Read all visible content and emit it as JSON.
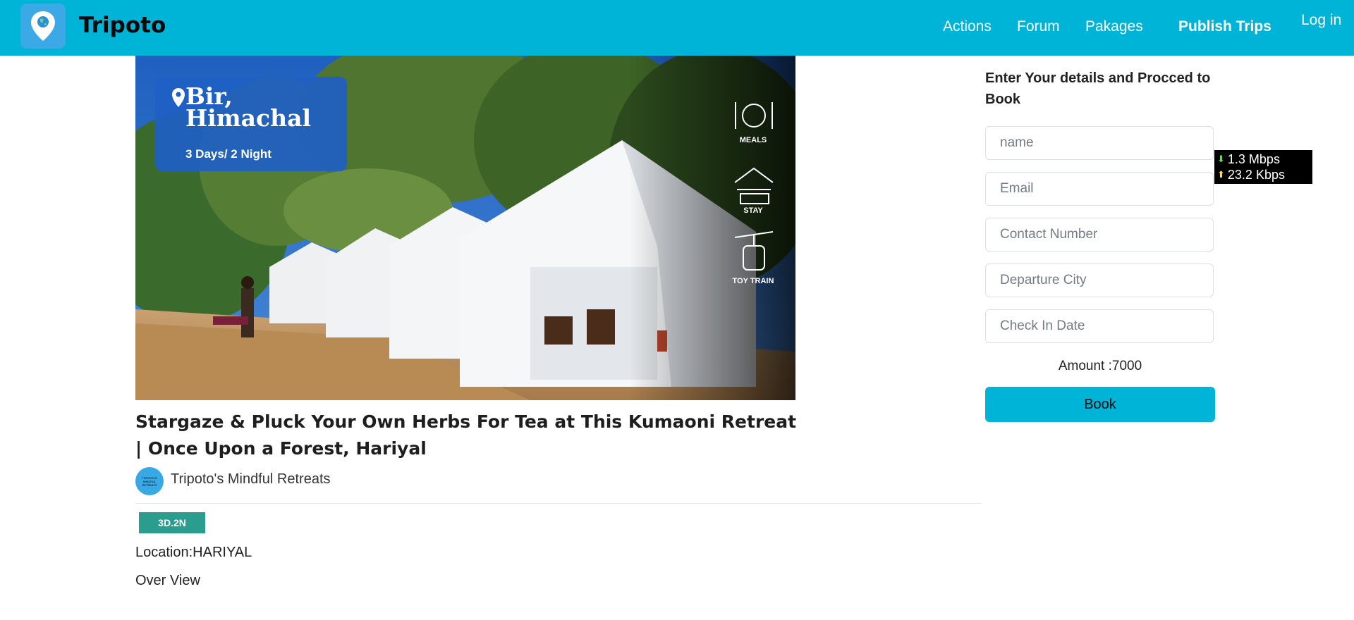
{
  "header": {
    "brand": "Tripoto",
    "nav": [
      {
        "label": "Actions"
      },
      {
        "label": "Forum"
      },
      {
        "label": "Pakages"
      },
      {
        "label": "Publish Trips"
      },
      {
        "label": "Log in"
      }
    ],
    "brand_color": "#00b4d8"
  },
  "hero": {
    "location_line1": "Bir,",
    "location_line2": "Himachal",
    "duration": "3 Days/ 2 Night",
    "amenities": [
      {
        "label": "MEALS",
        "icon": "plate-cutlery-icon"
      },
      {
        "label": "STAY",
        "icon": "bed-icon"
      },
      {
        "label": "TOY TRAIN",
        "icon": "cable-car-icon"
      }
    ]
  },
  "post": {
    "title": "Stargaze & Pluck Your Own Herbs For Tea at This Kumaoni Retreat | Once Upon a Forest, Hariyal",
    "author": "Tripoto's Mindful Retreats",
    "avatar_text": "TRIPOTO'S MINDFUL RETREATS",
    "badge": "3D.2N",
    "location": "Location:HARIYAL",
    "overview": "Over View"
  },
  "booking": {
    "title": "Enter Your details and Procced to Book",
    "fields": [
      {
        "placeholder": "name"
      },
      {
        "placeholder": "Email"
      },
      {
        "placeholder": "Contact Number"
      },
      {
        "placeholder": "Departure City"
      },
      {
        "placeholder": "Check In Date"
      }
    ],
    "amount": "Amount :7000",
    "book_label": "Book"
  },
  "network": {
    "down": "1.3 Mbps",
    "up": "23.2 Kbps"
  }
}
